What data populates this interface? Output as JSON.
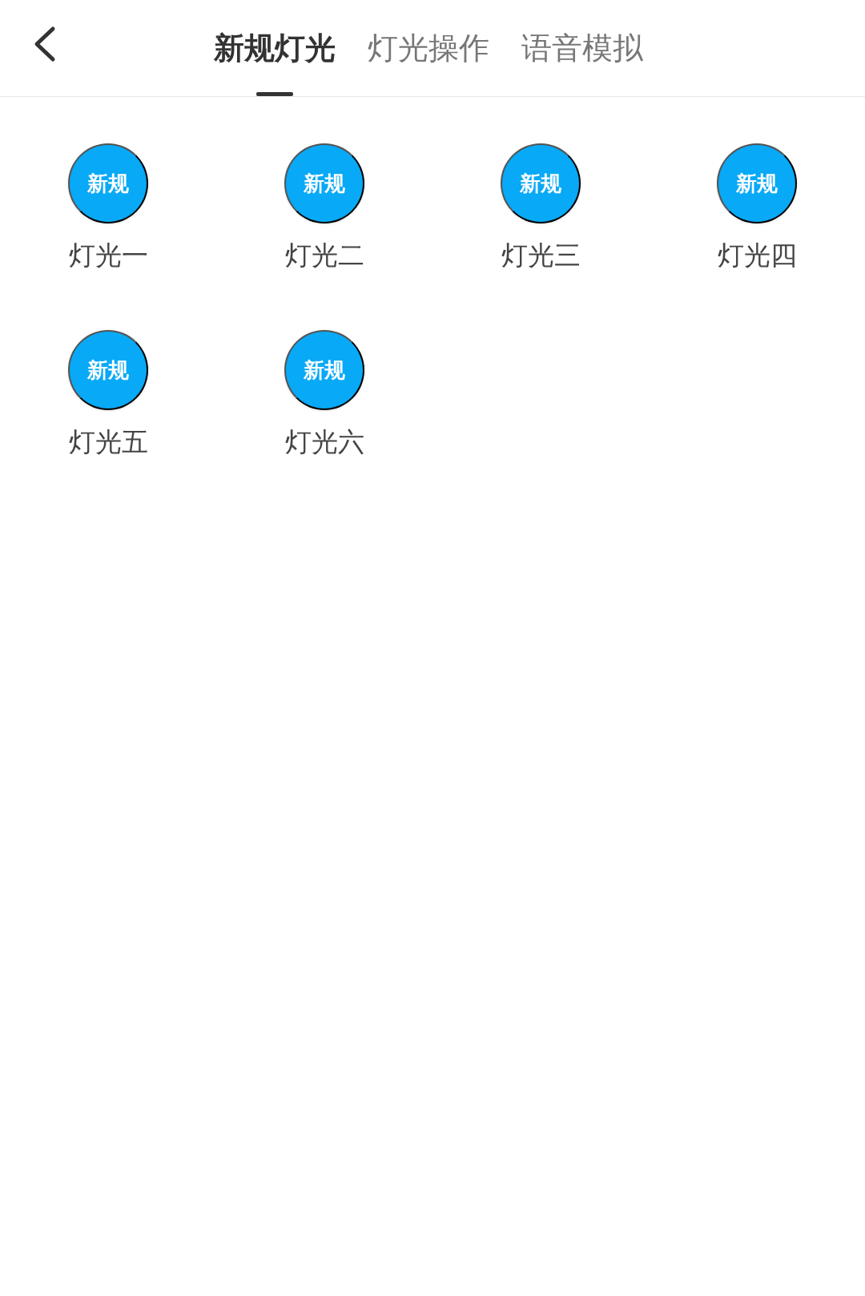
{
  "header": {
    "tabs": [
      {
        "label": "新规灯光",
        "selected": true
      },
      {
        "label": "灯光操作",
        "selected": false
      },
      {
        "label": "语音模拟",
        "selected": false
      }
    ]
  },
  "items": [
    {
      "badge": "新规",
      "label": "灯光一"
    },
    {
      "badge": "新规",
      "label": "灯光二"
    },
    {
      "badge": "新规",
      "label": "灯光三"
    },
    {
      "badge": "新规",
      "label": "灯光四"
    },
    {
      "badge": "新规",
      "label": "灯光五"
    },
    {
      "badge": "新规",
      "label": "灯光六"
    }
  ]
}
